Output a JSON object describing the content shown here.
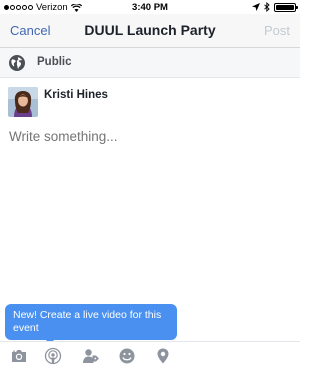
{
  "status_bar": {
    "carrier": "Verizon",
    "signal_bars": 1,
    "time": "3:40 PM",
    "battery_level": 1.0
  },
  "nav": {
    "cancel_label": "Cancel",
    "title": "DUUL Launch Party",
    "post_label": "Post"
  },
  "audience": {
    "icon": "globe-icon",
    "label": "Public"
  },
  "author": {
    "name": "Kristi Hines"
  },
  "composer": {
    "placeholder": "Write something..."
  },
  "tooltip": {
    "text": "New! Create a live video for this event"
  },
  "toolbar": {
    "icons": [
      "camera-icon",
      "live-video-icon",
      "tag-people-icon",
      "feeling-icon",
      "location-icon"
    ]
  },
  "colors": {
    "accent": "#4267b2",
    "disabled": "#c4c9d2",
    "tooltip_bg": "#4a90f0",
    "toolbar_icon": "#8d949e"
  }
}
